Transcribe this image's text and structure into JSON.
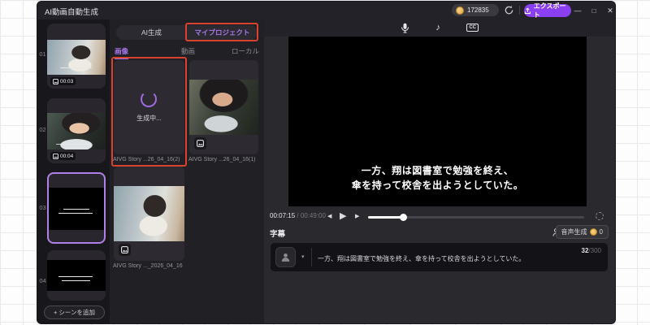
{
  "titlebar": {
    "title": "AI動画自動生成",
    "credits": "172835",
    "export_label": "エクスポート"
  },
  "glyphs": {
    "minimize": "—",
    "maximize": "□",
    "close": "✕",
    "prev": "◀",
    "play": "▶",
    "next": "▶",
    "caret": "▾",
    "music_note": "♪",
    "cc": "CC",
    "plus": "+"
  },
  "scene_panel": {
    "items": [
      {
        "num": "01",
        "duration": "00:03"
      },
      {
        "num": "02",
        "duration": "00:04"
      },
      {
        "num": "03",
        "duration": ""
      },
      {
        "num": "04",
        "duration": ""
      }
    ],
    "add_scene_label": "+ シーンを追加"
  },
  "library_panel": {
    "tab_ai": "AI生成",
    "tab_myproject": "マイプロジェクト",
    "subtab_image": "画像",
    "subtab_video": "動画",
    "subtab_local": "ローカル",
    "cards": [
      {
        "status": "生成中...",
        "label": "AIVG Story ...26_04_16(2)"
      },
      {
        "label": "AIVG Story ...26_04_16(1)"
      },
      {
        "label": "AIVG Story ..._2026_04_16"
      }
    ]
  },
  "player": {
    "subtitle_line1": "一方、翔は図書室で勉強を終え、",
    "subtitle_line2": "傘を持って校舎を出ようとしていた。",
    "current_time": "00:07:15",
    "time_separator": " / ",
    "total_time": "00:49:00",
    "progress_percent": 16
  },
  "caption_panel": {
    "title": "字幕",
    "voice_generate_label": "音声生成",
    "voice_credit_count": "0",
    "caption_text": "一方、翔は図書室で勉強を終え、傘を持って校舎を出ようとしていた。",
    "char_count": "32",
    "char_limit": "/300"
  },
  "colors": {
    "accent_purple": "#a777e8",
    "annotation_red": "#d8432f",
    "export_purple": "#8a3ff0",
    "coin_gold": "#e3a83f",
    "selected_scene_border": "#b07fe8"
  }
}
